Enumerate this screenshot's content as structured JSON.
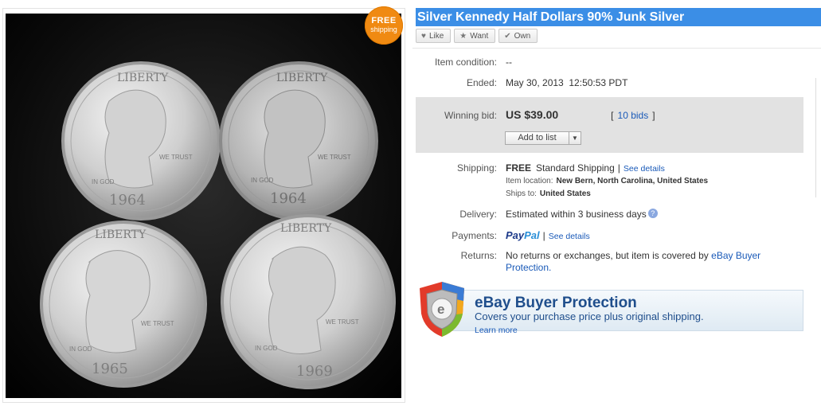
{
  "listing": {
    "title": "Silver Kennedy Half Dollars 90% Junk Silver",
    "badge_line1": "FREE",
    "badge_line2": "shipping"
  },
  "social": {
    "like": "Like",
    "want": "Want",
    "own": "Own"
  },
  "details": {
    "condition_label": "Item condition:",
    "condition_value": "--",
    "ended_label": "Ended:",
    "ended_value": "May 30, 2013  12:50:53 PDT",
    "winning_label": "Winning bid:",
    "winning_value": "US $39.00",
    "bids_open": "[",
    "bids_link": "10 bids",
    "bids_close": "]",
    "add_to_list": "Add to list",
    "shipping_label": "Shipping:",
    "shipping_free": "FREE",
    "shipping_method": "Standard Shipping",
    "shipping_sep": "|",
    "see_details": "See details",
    "item_location_label": "Item location:",
    "item_location_value": "New Bern, North Carolina, United States",
    "ships_to_label": "Ships to:",
    "ships_to_value": "United States",
    "delivery_label": "Delivery:",
    "delivery_value": "Estimated within 3 business days",
    "payments_label": "Payments:",
    "paypal_1": "Pay",
    "paypal_2": "Pal",
    "payments_sep": "|",
    "payments_see_details": "See details",
    "returns_label": "Returns:",
    "returns_value": "No returns or exchanges, but item is covered by",
    "returns_link": "eBay Buyer Protection."
  },
  "protection": {
    "title": "eBay Buyer Protection",
    "subtitle": "Covers your purchase price plus original shipping.",
    "learn_more": "Learn more",
    "shield_letter": "e"
  },
  "coins": {
    "coin1_year": "1964",
    "coin2_year": "1964",
    "coin3_year": "1965",
    "coin4_year": "1969",
    "legend_top": "LIBERTY",
    "motto_left": "IN GOD",
    "motto_right": "WE TRUST"
  }
}
